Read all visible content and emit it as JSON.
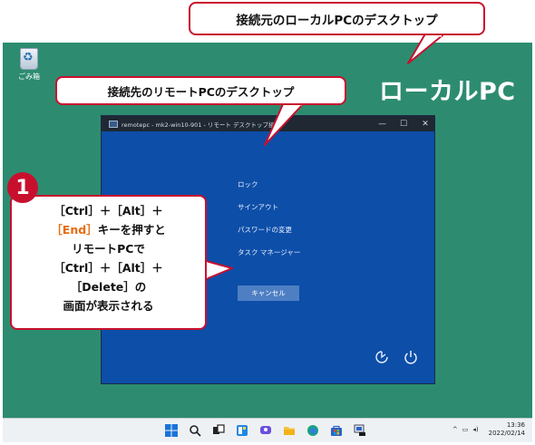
{
  "callouts": {
    "local_desktop": "接続元のローカルPCのデスクトップ",
    "remote_desktop": "接続先のリモートPCのデスクトップ",
    "step_number": "1",
    "step_lines": {
      "line1": "［Ctrl］＋［Alt］＋",
      "line2_key": "［End］",
      "line2_rest": "キーを押すと",
      "line3": "リモートPCで",
      "line4": "［Ctrl］＋［Alt］＋",
      "line5": "［Delete］の",
      "line6": "画面が表示される"
    }
  },
  "desktop": {
    "label": "ローカルPC",
    "recycle_bin_label": "ごみ箱"
  },
  "remote_window": {
    "title": "remotepc - mk2-win10-901 - リモート デスクトップ接続",
    "menu_items": [
      "ロック",
      "サインアウト",
      "パスワードの変更",
      "タスク マネージャー"
    ],
    "cancel_label": "キャンセル"
  },
  "taskbar": {
    "icons": [
      "windows-start-icon",
      "search-icon",
      "task-view-icon",
      "widgets-icon",
      "chat-icon",
      "file-explorer-icon",
      "edge-icon",
      "store-icon",
      "remote-desktop-icon"
    ],
    "clock_time": "13:36",
    "clock_date": "2022/02/14"
  },
  "colors": {
    "callout_border": "#c8102e",
    "accent_orange": "#e86b0a",
    "desktop_bg": "#2d8c70",
    "remote_bg": "#0d4ea8"
  }
}
